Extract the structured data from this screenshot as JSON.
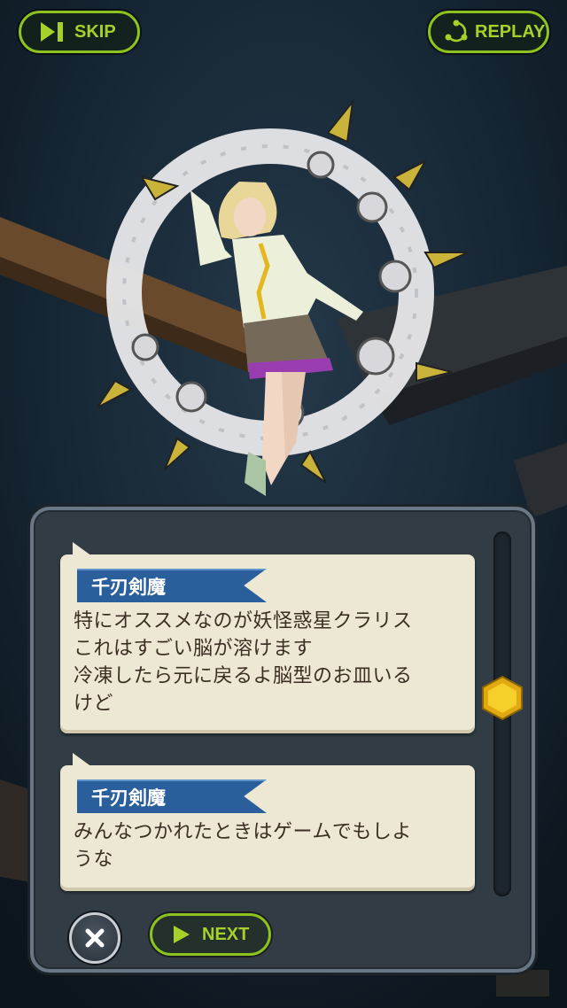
{
  "top_bar": {
    "skip_label": "SKIP",
    "replay_label": "REPLAY"
  },
  "dialog": {
    "messages": [
      {
        "speaker": "千刃剣魔",
        "text": "特にオススメなのが妖怪惑星クラリス\nこれはすごい脳が溶けます\n冷凍したら元に戻るよ脳型のお皿いる\nけど"
      },
      {
        "speaker": "千刃剣魔",
        "text": "みんなつかれたときはゲームでもしよ\nうな"
      }
    ],
    "scroll_position": 0.45
  },
  "controls": {
    "next_label": "NEXT"
  },
  "colors": {
    "accent": "#8dc21f",
    "name_tag": "#2a5f9c",
    "bubble": "#ede8d4",
    "thumb": "#f0c419"
  },
  "icons": {
    "skip": "skip-icon",
    "replay": "replay-icon",
    "close": "close-icon",
    "next": "play-icon"
  }
}
